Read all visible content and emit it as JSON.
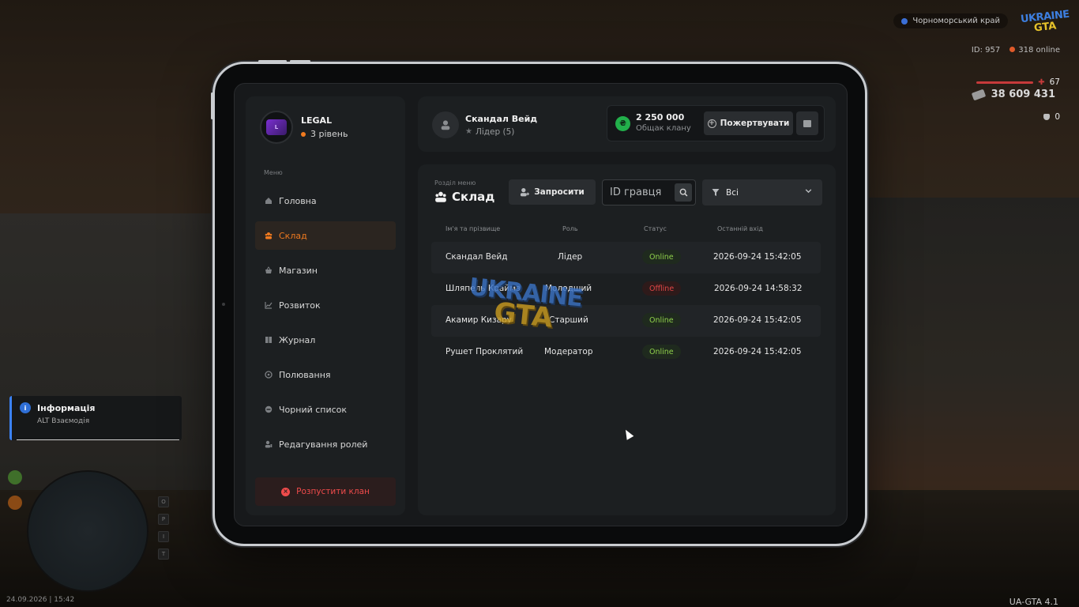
{
  "hud": {
    "region": "Чорноморський край",
    "logo_line1": "UKRAINE",
    "logo_line2": "GTA",
    "player_id": "ID: 957",
    "online": "318 online",
    "health": "67",
    "armor": "0",
    "money": "38 609 431",
    "datetime": "24.09.2026 | 15:42",
    "version": "UA-GTA 4.1"
  },
  "info_box": {
    "title": "Інформація",
    "subtitle": "ALT Взаємодія"
  },
  "clan": {
    "name": "LEGAL",
    "level": "3 рівень"
  },
  "sidebar": {
    "caption": "Меню",
    "items": [
      {
        "label": "Головна",
        "icon": "home-icon",
        "active": false
      },
      {
        "label": "Склад",
        "icon": "users-icon",
        "active": true
      },
      {
        "label": "Магазин",
        "icon": "basket-icon",
        "active": false
      },
      {
        "label": "Розвиток",
        "icon": "chart-icon",
        "active": false
      },
      {
        "label": "Журнал",
        "icon": "book-icon",
        "active": false
      },
      {
        "label": "Полювання",
        "icon": "target-icon",
        "active": false
      },
      {
        "label": "Чорний список",
        "icon": "block-icon",
        "active": false
      },
      {
        "label": "Редагування ролей",
        "icon": "user-edit-icon",
        "active": false
      }
    ],
    "dissolve_label": "Розпустити клан"
  },
  "leader": {
    "name": "Скандал Вейд",
    "role": "Лідер (5)"
  },
  "bank": {
    "amount": "2 250 000",
    "label": "Общак клану",
    "donate_label": "Пожертвувати"
  },
  "main": {
    "section_caption": "Розділ меню",
    "section_title": "Склад",
    "invite_label": "Запросити",
    "search_placeholder": "ID гравця",
    "filter_value": "Всі",
    "columns": [
      "Ім'я та прізвище",
      "Роль",
      "Статус",
      "Останній вхід"
    ],
    "rows": [
      {
        "name": "Скандал Вейд",
        "role": "Лідер",
        "status": "Online",
        "last": "2026-09-24 15:42:05"
      },
      {
        "name": "Шляпель Краймз",
        "role": "Молодший",
        "status": "Offline",
        "last": "2026-09-24 14:58:32"
      },
      {
        "name": "Акамир Кизару",
        "role": "Старший",
        "status": "Online",
        "last": "2026-09-24 15:42:05"
      },
      {
        "name": "Рушет Проклятий",
        "role": "Модератор",
        "status": "Online",
        "last": "2026-09-24 15:42:05"
      }
    ]
  },
  "colors": {
    "accent": "#f07a1f",
    "online": "#8fd14b",
    "offline": "#e04646",
    "danger": "#ef4b4b",
    "coin": "#22b04b"
  }
}
